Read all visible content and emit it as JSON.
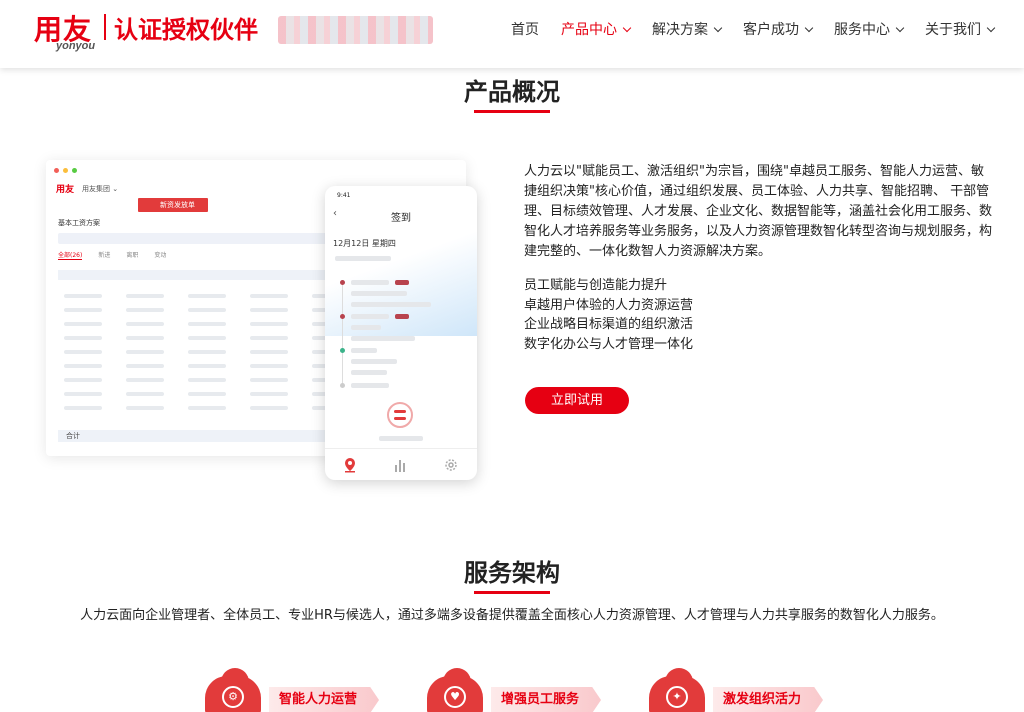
{
  "header": {
    "logo_cn": "用友",
    "logo_en": "yonyou",
    "partner_label": "认证授权伙伴",
    "nav": [
      {
        "label": "首页",
        "dropdown": false,
        "active": false
      },
      {
        "label": "产品中心",
        "dropdown": true,
        "active": true
      },
      {
        "label": "解决方案",
        "dropdown": true,
        "active": false
      },
      {
        "label": "客户成功",
        "dropdown": true,
        "active": false
      },
      {
        "label": "服务中心",
        "dropdown": true,
        "active": false
      },
      {
        "label": "关于我们",
        "dropdown": true,
        "active": false
      }
    ]
  },
  "overview": {
    "title": "产品概况",
    "intro": "人力云以\"赋能员工、激活组织\"为宗旨，围绕\"卓越员工服务、智能人力运营、敏捷组织决策\"核心价值，通过组织发展、员工体验、人力共享、智能招聘、 干部管理、目标绩效管理、人才发展、企业文化、数据智能等，涵盖社会化用工服务、数智化人才培养服务等业务服务，以及人力资源管理数智化转型咨询与规划服务，构建完整的、一体化数智人力资源解决方案。",
    "features": [
      "员工赋能与创造能力提升",
      "卓越用户体验的人力资源运营",
      "企业战略目标渠道的组织激活",
      "数字化办公与人才管理一体化"
    ],
    "cta_label": "立即试用"
  },
  "mockup": {
    "desk_logo": "用友",
    "desk_group": "用友集团 ⌄",
    "desk_button": "新资发放单",
    "desk_plan": "基本工资方案",
    "desk_tabs": [
      "全部(26)",
      "新进",
      "离职",
      "变动"
    ],
    "desk_total": "合计",
    "phone_time": "9:41",
    "phone_title": "签到",
    "phone_date": "12月12日 星期四"
  },
  "architecture": {
    "title": "服务架构",
    "description": "人力云面向企业管理者、全体员工、专业HR与候选人，通过多端多设备提供覆盖全面核心人力资源管理、人才管理与人力共享服务的数智化人力服务。",
    "services": [
      {
        "label": "智能人力运营",
        "icon": "gear-person-icon"
      },
      {
        "label": "增强员工服务",
        "icon": "heart-icon"
      },
      {
        "label": "激发组织活力",
        "icon": "lightbulb-icon"
      }
    ]
  },
  "colors": {
    "brand": "#e60012",
    "accent_light": "#fdeaea"
  }
}
